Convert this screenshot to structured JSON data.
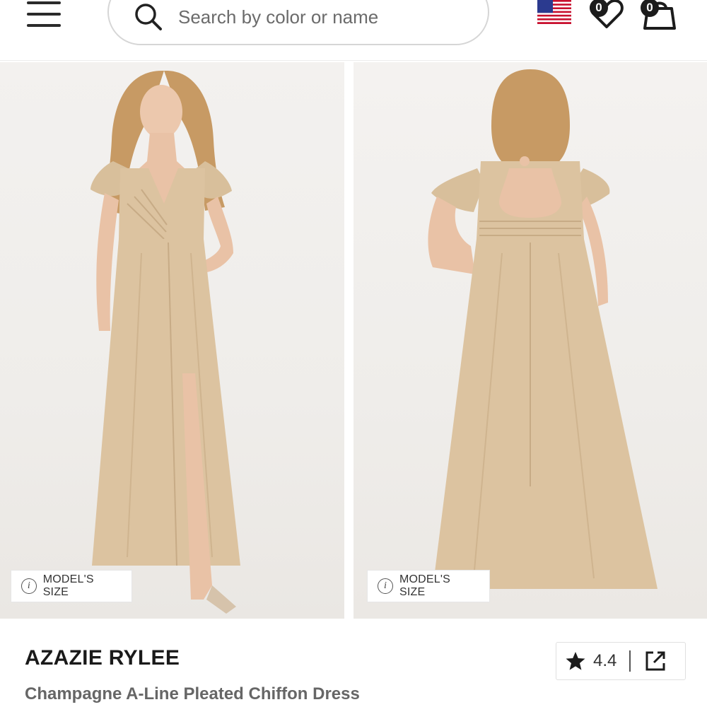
{
  "header": {
    "search_placeholder": "Search by color or name",
    "wishlist_count": "0",
    "cart_count": "0",
    "icons": {
      "menu": "hamburger-menu-icon",
      "search": "search-icon",
      "flag": "us-flag-icon",
      "wishlist": "heart-icon",
      "cart": "shopping-bag-icon"
    }
  },
  "gallery": {
    "images": [
      {
        "label": "MODEL'S SIZE",
        "view": "front"
      },
      {
        "label": "MODEL'S SIZE",
        "view": "back"
      }
    ]
  },
  "product": {
    "brand_name": "AZAZIE RYLEE",
    "description": "Champagne A-Line Pleated Chiffon Dress",
    "rating": "4.4"
  },
  "colors": {
    "dress": "#dcc3a0",
    "dress_shadow": "#c7ab86",
    "skin": "#e9c2a6",
    "hair": "#c79a64",
    "background": "#f1efec"
  }
}
